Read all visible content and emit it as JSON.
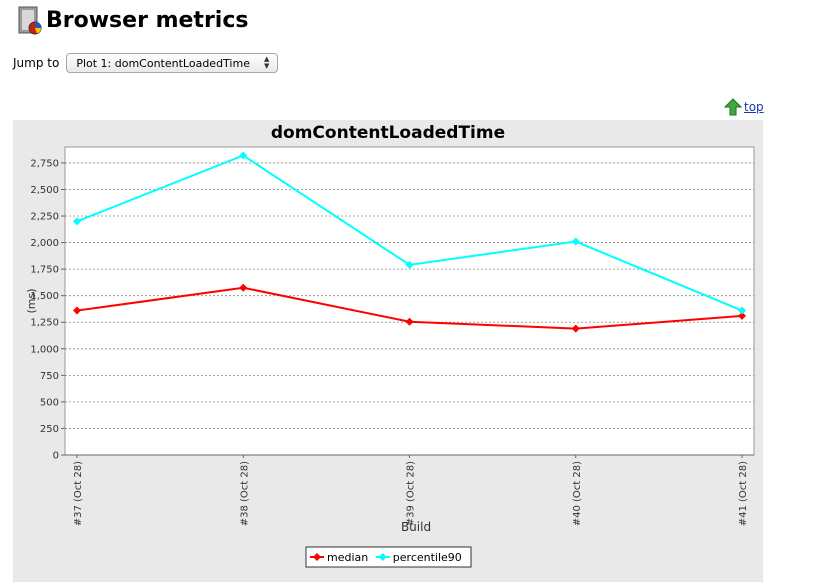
{
  "page": {
    "title": "Browser metrics",
    "jump_label": "Jump to",
    "jump_selected": "Plot 1: domContentLoadedTime",
    "top_link": "top"
  },
  "chart_data": {
    "type": "line",
    "title": "domContentLoadedTime",
    "xlabel": "Build",
    "ylabel": "(ms)",
    "categories": [
      "#37 (Oct 28)",
      "#38 (Oct 28)",
      "#39 (Oct 28)",
      "#40 (Oct 28)",
      "#41 (Oct 28)"
    ],
    "ylim": [
      0,
      2900
    ],
    "yticks": [
      0,
      250,
      500,
      750,
      1000,
      1250,
      1500,
      1750,
      2000,
      2250,
      2500,
      2750
    ],
    "ytick_labels": [
      "0",
      "250",
      "500",
      "750",
      "1,000",
      "1,250",
      "1,500",
      "1,750",
      "2,000",
      "2,250",
      "2,500",
      "2,750"
    ],
    "grid": true,
    "legend_position": "bottom-center",
    "series": [
      {
        "name": "median",
        "color": "#ff0000",
        "values": [
          1360,
          1575,
          1255,
          1190,
          1310
        ]
      },
      {
        "name": "percentile90",
        "color": "#00ffff",
        "values": [
          2200,
          2820,
          1790,
          2010,
          1360
        ]
      }
    ]
  }
}
